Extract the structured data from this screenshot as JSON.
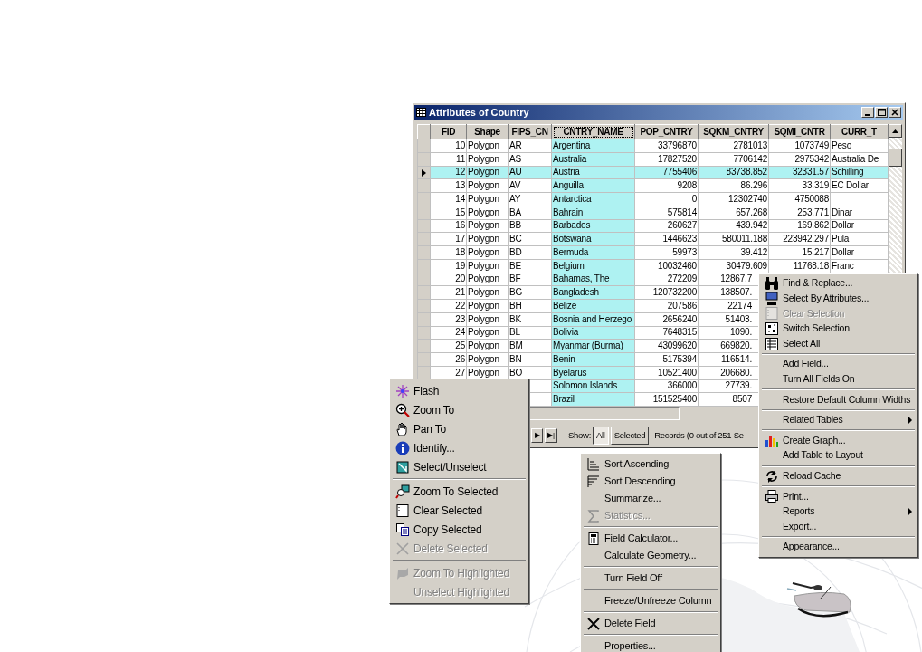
{
  "window": {
    "title": "Attributes of Country"
  },
  "table": {
    "columns": [
      {
        "name": "FID",
        "selected": false,
        "kind": "number"
      },
      {
        "name": "Shape",
        "selected": false,
        "kind": "text"
      },
      {
        "name": "FIPS_CN",
        "selected": false,
        "kind": "text"
      },
      {
        "name": "CNTRY_NAME",
        "selected": true,
        "kind": "text"
      },
      {
        "name": "POP_CNTRY",
        "selected": false,
        "kind": "number"
      },
      {
        "name": "SQKM_CNTRY",
        "selected": false,
        "kind": "number"
      },
      {
        "name": "SQMI_CNTR",
        "selected": false,
        "kind": "number"
      },
      {
        "name": "CURR_T",
        "selected": false,
        "kind": "text"
      }
    ],
    "rows": [
      {
        "kind": "full",
        "selected": false,
        "cells": [
          "10",
          "Polygon",
          "AR",
          "Argentina",
          "33796870",
          "2781013",
          "1073749",
          "Peso"
        ]
      },
      {
        "kind": "full",
        "selected": false,
        "cells": [
          "11",
          "Polygon",
          "AS",
          "Australia",
          "17827520",
          "7706142",
          "2975342",
          "Australia De"
        ]
      },
      {
        "kind": "full",
        "selected": true,
        "cells": [
          "12",
          "Polygon",
          "AU",
          "Austria",
          "7755406",
          "83738.852",
          "32331.57",
          "Schilling"
        ]
      },
      {
        "kind": "full",
        "selected": false,
        "cells": [
          "13",
          "Polygon",
          "AV",
          "Anguilla",
          "9208",
          "86.296",
          "33.319",
          "EC Dollar"
        ]
      },
      {
        "kind": "full",
        "selected": false,
        "cells": [
          "14",
          "Polygon",
          "AY",
          "Antarctica",
          "0",
          "12302740",
          "4750088"
        ]
      },
      {
        "kind": "full",
        "selected": false,
        "cells": [
          "15",
          "Polygon",
          "BA",
          "Bahrain",
          "575814",
          "657.268",
          "253.771",
          "Dinar"
        ]
      },
      {
        "kind": "full",
        "selected": false,
        "cells": [
          "16",
          "Polygon",
          "BB",
          "Barbados",
          "260627",
          "439.942",
          "169.862",
          "Dollar"
        ]
      },
      {
        "kind": "full",
        "selected": false,
        "cells": [
          "17",
          "Polygon",
          "BC",
          "Botswana",
          "1446623",
          "580011.188",
          "223942.297",
          "Pula"
        ]
      },
      {
        "kind": "full",
        "selected": false,
        "cells": [
          "18",
          "Polygon",
          "BD",
          "Bermuda",
          "59973",
          "39.412",
          "15.217",
          "Dollar"
        ]
      },
      {
        "kind": "full",
        "selected": false,
        "cells": [
          "19",
          "Polygon",
          "BE",
          "Belgium",
          "10032460",
          "30479.609",
          "11768.18",
          "Franc"
        ]
      },
      {
        "kind": "covered_right",
        "selected": false,
        "cells": [
          "20",
          "Polygon",
          "BF",
          "Bahamas, The",
          "272209",
          "12867.7"
        ]
      },
      {
        "kind": "covered_right",
        "selected": false,
        "cells": [
          "21",
          "Polygon",
          "BG",
          "Bangladesh",
          "120732200",
          "138507."
        ]
      },
      {
        "kind": "covered_right",
        "selected": false,
        "cells": [
          "22",
          "Polygon",
          "BH",
          "Belize",
          "207586",
          "22174"
        ]
      },
      {
        "kind": "covered_right",
        "selected": false,
        "cells": [
          "23",
          "Polygon",
          "BK",
          "Bosnia and Herzego",
          "2656240",
          "51403."
        ]
      },
      {
        "kind": "covered_right",
        "selected": false,
        "cells": [
          "24",
          "Polygon",
          "BL",
          "Bolivia",
          "7648315",
          "1090."
        ]
      },
      {
        "kind": "covered_right",
        "selected": false,
        "cells": [
          "25",
          "Polygon",
          "BM",
          "Myanmar (Burma)",
          "43099620",
          "669820."
        ]
      },
      {
        "kind": "covered_right",
        "selected": false,
        "cells": [
          "26",
          "Polygon",
          "BN",
          "Benin",
          "5175394",
          "116514."
        ]
      },
      {
        "kind": "covered_right",
        "selected": false,
        "cells": [
          "27",
          "Polygon",
          "BO",
          "Byelarus",
          "10521400",
          "206680."
        ]
      },
      {
        "kind": "covered_both",
        "selected": false,
        "cells": [
          "Solomon Islands",
          "366000",
          "27739."
        ]
      },
      {
        "kind": "covered_both",
        "selected": false,
        "cells": [
          "Brazil",
          "151525400",
          "8507"
        ]
      }
    ]
  },
  "footer": {
    "nav_buttons": [
      "▶",
      "▶|"
    ],
    "show_label": "Show:",
    "show_options": [
      {
        "label": "All",
        "selected": true
      },
      {
        "label": "Selected",
        "selected": false
      }
    ],
    "records": "Records (0 out of 251 Se"
  },
  "menus": [
    {
      "groups": [
        [
          {
            "label": "Flash",
            "disabled": false,
            "submenu": false
          },
          {
            "label": "Zoom To",
            "disabled": false,
            "submenu": false
          },
          {
            "label": "Pan To",
            "disabled": false,
            "submenu": false
          },
          {
            "label": "Identify...",
            "disabled": false,
            "submenu": false
          },
          {
            "label": "Select/Unselect",
            "disabled": false,
            "submenu": false
          }
        ],
        [
          {
            "label": "Zoom To Selected",
            "disabled": false,
            "submenu": false
          },
          {
            "label": "Clear Selected",
            "disabled": false,
            "submenu": false
          },
          {
            "label": "Copy Selected",
            "disabled": false,
            "submenu": false
          },
          {
            "label": "Delete Selected",
            "disabled": true,
            "submenu": false
          }
        ],
        [
          {
            "label": "Zoom To Highlighted",
            "disabled": true,
            "submenu": false
          },
          {
            "label": "Unselect Highlighted",
            "disabled": true,
            "submenu": false
          }
        ]
      ]
    },
    {
      "groups": [
        [
          {
            "label": "Sort Ascending",
            "disabled": false,
            "submenu": false
          },
          {
            "label": "Sort Descending",
            "disabled": false,
            "submenu": false
          },
          {
            "label": "Summarize...",
            "disabled": false,
            "submenu": false
          },
          {
            "label": "Statistics...",
            "disabled": true,
            "submenu": false
          }
        ],
        [
          {
            "label": "Field Calculator...",
            "disabled": false,
            "submenu": false
          },
          {
            "label": "Calculate Geometry...",
            "disabled": false,
            "submenu": false
          }
        ],
        [
          {
            "label": "Turn Field Off",
            "disabled": false,
            "submenu": false
          }
        ],
        [
          {
            "label": "Freeze/Unfreeze Column",
            "disabled": false,
            "submenu": false
          }
        ],
        [
          {
            "label": "Delete Field",
            "disabled": false,
            "submenu": false
          }
        ],
        [
          {
            "label": "Properties...",
            "disabled": false,
            "submenu": false
          }
        ]
      ]
    },
    {
      "groups": [
        [
          {
            "label": "Find & Replace...",
            "disabled": false,
            "submenu": false
          },
          {
            "label": "Select By Attributes...",
            "disabled": false,
            "submenu": false
          },
          {
            "label": "Clear Selection",
            "disabled": true,
            "submenu": false
          },
          {
            "label": "Switch Selection",
            "disabled": false,
            "submenu": false
          },
          {
            "label": "Select All",
            "disabled": false,
            "submenu": false
          }
        ],
        [
          {
            "label": "Add Field...",
            "disabled": false,
            "submenu": false
          },
          {
            "label": "Turn All Fields On",
            "disabled": false,
            "submenu": false
          }
        ],
        [
          {
            "label": "Restore Default Column Widths",
            "disabled": false,
            "submenu": false
          }
        ],
        [
          {
            "label": "Related Tables",
            "disabled": false,
            "submenu": true
          }
        ],
        [
          {
            "label": "Create Graph...",
            "disabled": false,
            "submenu": false
          },
          {
            "label": "Add Table to Layout",
            "disabled": false,
            "submenu": false
          }
        ],
        [
          {
            "label": "Reload Cache",
            "disabled": false,
            "submenu": false
          }
        ],
        [
          {
            "label": "Print...",
            "disabled": false,
            "submenu": false
          },
          {
            "label": "Reports",
            "disabled": false,
            "submenu": true
          },
          {
            "label": "Export...",
            "disabled": false,
            "submenu": false
          }
        ],
        [
          {
            "label": "Appearance...",
            "disabled": false,
            "submenu": false
          }
        ]
      ]
    }
  ]
}
